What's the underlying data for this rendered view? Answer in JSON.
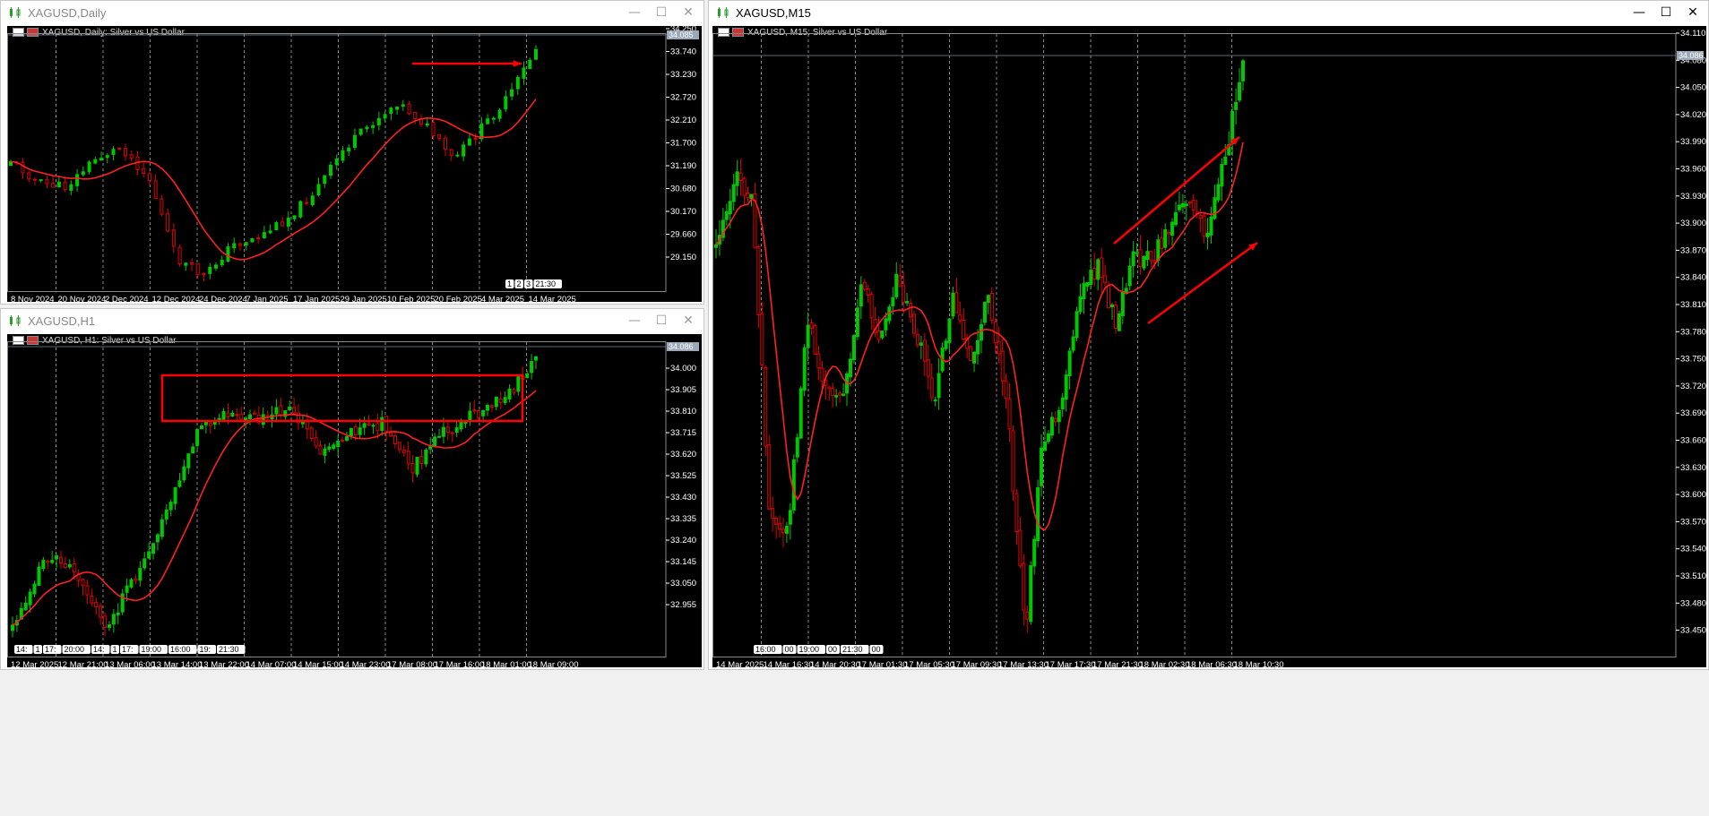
{
  "windows": {
    "daily": {
      "title": "XAGUSD,Daily",
      "label": "XAGUSD, Daily:  Silver vs US Dollar",
      "price_axis": [
        "34.250",
        "33.740",
        "33.230",
        "32.720",
        "32.210",
        "31.700",
        "31.190",
        "30.680",
        "30.170",
        "29.660",
        "29.150"
      ],
      "current_price": "34.085",
      "time_axis": [
        "8 Nov 2024",
        "20 Nov 2024",
        "2 Dec 2024",
        "12 Dec 2024",
        "24 Dec 2024",
        "7 Jan 2025",
        "17 Jan 2025",
        "29 Jan 2025",
        "10 Feb 2025",
        "20 Feb 2025",
        "4 Mar 2025",
        "14 Mar 2025"
      ],
      "markers": [
        "1",
        "2",
        "3",
        "21:30"
      ]
    },
    "h1": {
      "title": "XAGUSD,H1",
      "label": "XAGUSD, H1:  Silver vs US Dollar",
      "price_axis": [
        "34.000",
        "33.905",
        "33.810",
        "33.715",
        "33.620",
        "33.525",
        "33.430",
        "33.335",
        "33.240",
        "33.145",
        "33.050",
        "32.955"
      ],
      "current_price": "34.086",
      "time_axis": [
        "12 Mar 2025",
        "12 Mar 21:00",
        "13 Mar 06:00",
        "13 Mar 14:00",
        "13 Mar 22:00",
        "14 Mar 07:00",
        "14 Mar 15:00",
        "14 Mar 23:00",
        "17 Mar 08:00",
        "17 Mar 16:00",
        "18 Mar 01:00",
        "18 Mar 09:00"
      ],
      "markers": [
        "14:",
        "1",
        "17:",
        "20:00",
        "14:",
        "1",
        "17:",
        "19:00",
        "16:00",
        "19:",
        "21:30"
      ]
    },
    "m15": {
      "title": "XAGUSD,M15",
      "label": "XAGUSD, M15:  Silver vs US Dollar",
      "price_axis": [
        "34.110",
        "34.080",
        "34.050",
        "34.020",
        "33.990",
        "33.960",
        "33.930",
        "33.900",
        "33.870",
        "33.840",
        "33.810",
        "33.780",
        "33.750",
        "33.720",
        "33.690",
        "33.660",
        "33.630",
        "33.600",
        "33.570",
        "33.540",
        "33.510",
        "33.480",
        "33.450"
      ],
      "current_price": "34.086",
      "time_axis": [
        "14 Mar 2025",
        "14 Mar 16:30",
        "14 Mar 20:30",
        "17 Mar 01:30",
        "17 Mar 05:30",
        "17 Mar 09:30",
        "17 Mar 13:30",
        "17 Mar 17:30",
        "17 Mar 21:30",
        "18 Mar 02:30",
        "18 Mar 06:30",
        "18 Mar 10:30"
      ],
      "markers": [
        "16:00",
        "00",
        "19:00",
        "00",
        "21:30",
        "00"
      ]
    }
  },
  "colors": {
    "bull": "#00c800",
    "bear": "#e00000",
    "ma": "#ff2020",
    "grid": "#ffffff",
    "annotation": "#ff0000"
  },
  "icons": {
    "window": "chart-window-icon",
    "minimize": "minimize-icon",
    "maximize": "maximize-icon",
    "close": "close-icon"
  }
}
